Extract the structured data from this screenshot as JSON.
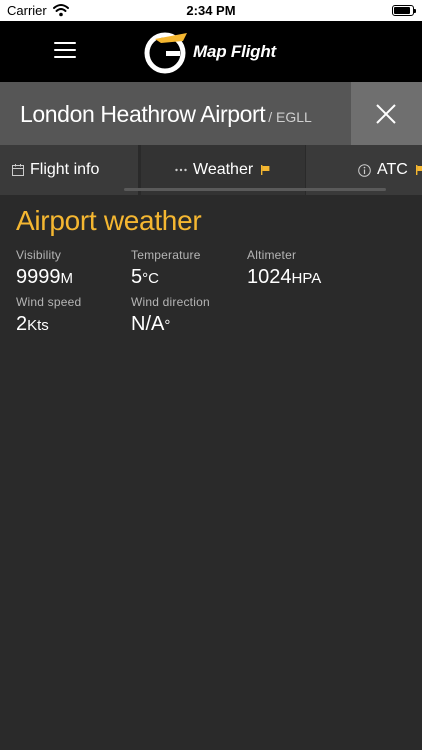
{
  "status_bar": {
    "carrier": "Carrier",
    "time": "2:34 PM"
  },
  "header": {
    "logo_text": "Map Flight",
    "menu_icon": "hamburger-menu-icon",
    "logo_icon": "map-flight-logo-icon"
  },
  "airport": {
    "name": "London Heathrow Airport",
    "code": "/ EGLL"
  },
  "tabs": [
    {
      "label": "Flight info",
      "icon": "calendar-icon"
    },
    {
      "label": "Weather",
      "icon": "ellipsis-icon",
      "flag": true
    },
    {
      "label": "ATC",
      "icon": "info-icon",
      "flag": true
    }
  ],
  "weather": {
    "title": "Airport weather",
    "visibility": {
      "label": "Visibility",
      "value": "9999",
      "unit": "M"
    },
    "temperature": {
      "label": "Temperature",
      "value": "5",
      "unit": "°C"
    },
    "altimeter": {
      "label": "Altimeter",
      "value": "1024",
      "unit": "HPA"
    },
    "wind_speed": {
      "label": "Wind speed",
      "value": "2",
      "unit": "Kts"
    },
    "wind_direction": {
      "label": "Wind direction",
      "value": "N/A",
      "unit": "°"
    }
  },
  "colors": {
    "accent": "#f5b731",
    "background": "#2a2a2a",
    "header": "#000000",
    "title_bar": "#565656"
  }
}
